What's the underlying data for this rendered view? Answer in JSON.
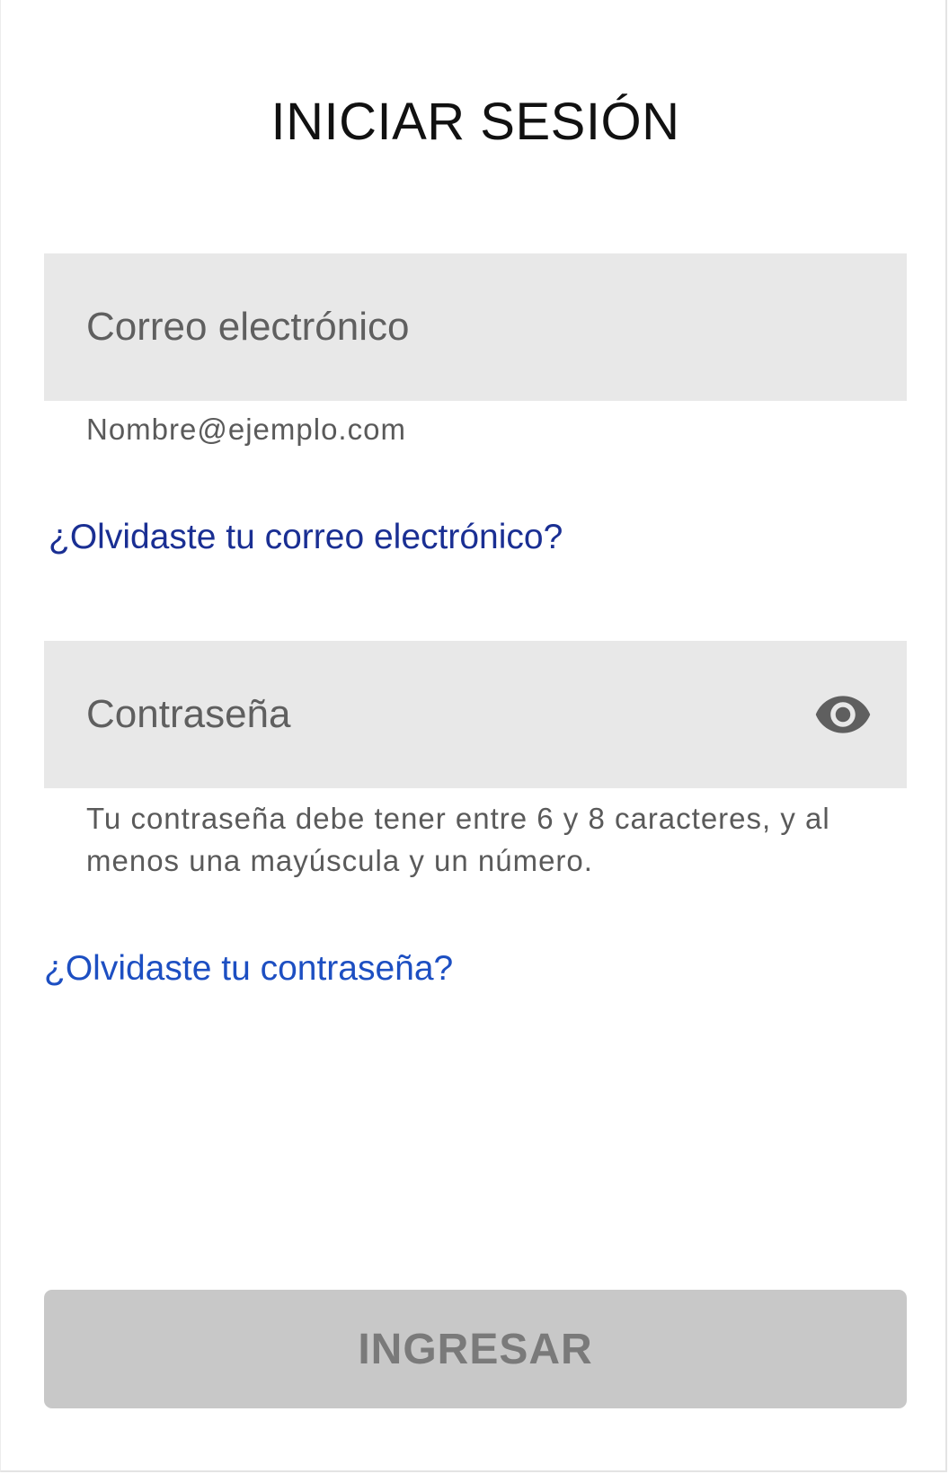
{
  "title": "INICIAR SESIÓN",
  "email": {
    "placeholder": "Correo electrónico",
    "value": "",
    "helper": "Nombre@ejemplo.com",
    "forgot_link": "¿Olvidaste tu correo electrónico?"
  },
  "password": {
    "placeholder": "Contraseña",
    "value": "",
    "helper": "Tu contraseña debe tener entre 6 y 8 caracteres, y al menos una mayúscula y un número.",
    "forgot_link": "¿Olvidaste tu contraseña?",
    "toggle_icon": "eye-icon"
  },
  "submit": {
    "label": "INGRESAR",
    "enabled": false
  },
  "colors": {
    "field_background": "#e8e8e8",
    "link_email": "#1a2f93",
    "link_password": "#1d4fc2",
    "button_disabled_bg": "#c8c8c8",
    "button_disabled_text": "#7a7a7a"
  }
}
